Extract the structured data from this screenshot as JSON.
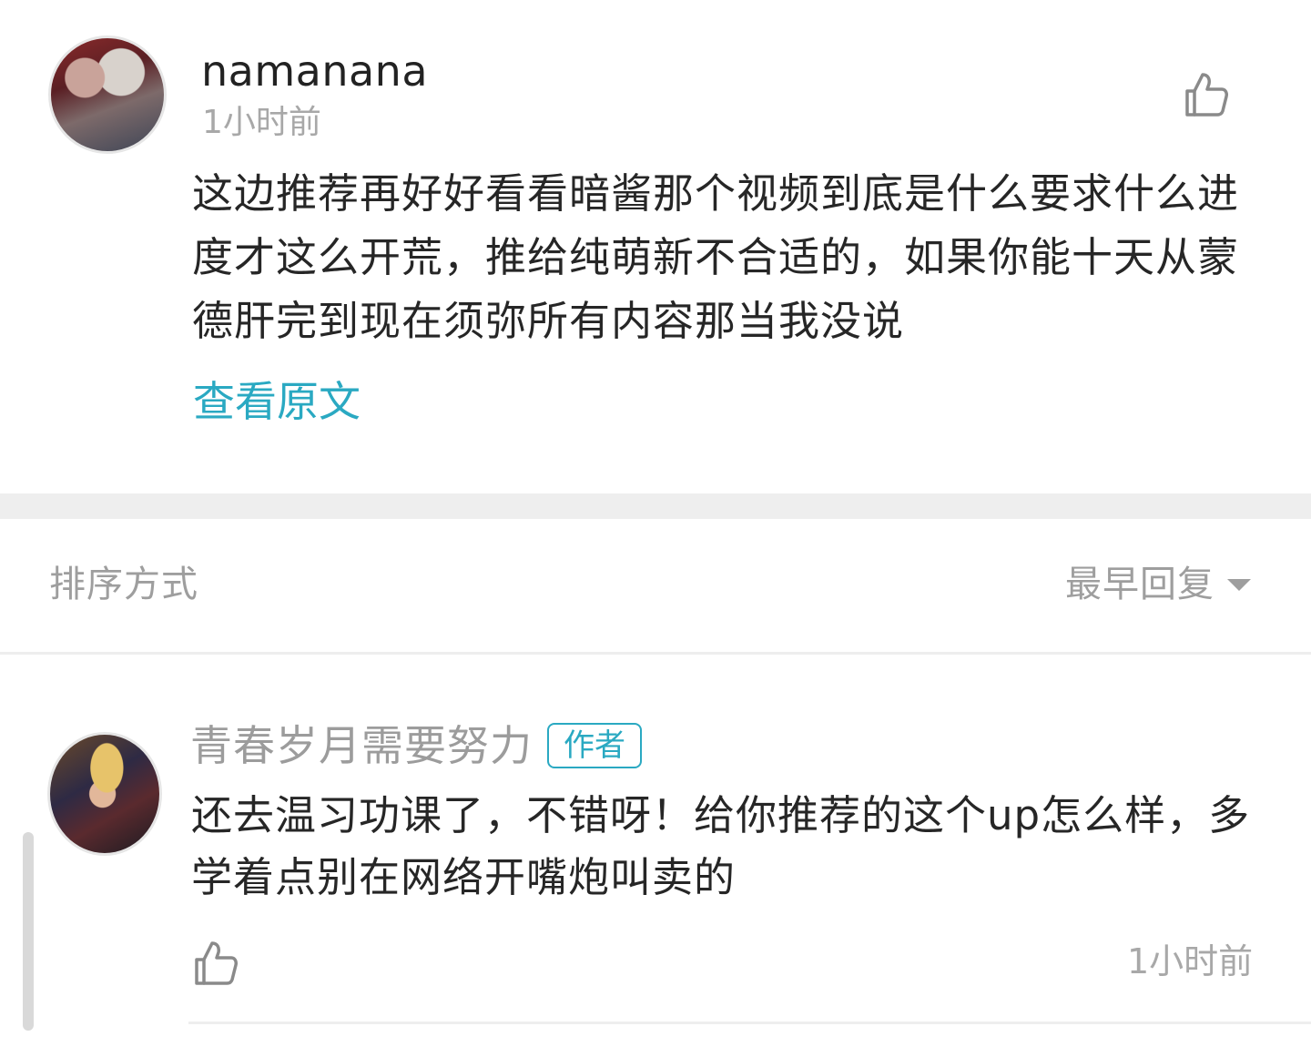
{
  "top_comment": {
    "username": "namanana",
    "time": "1小时前",
    "text": "这边推荐再好好看看暗酱那个视频到底是什么要求什么进度才这么开荒，推给纯萌新不合适的，如果你能十天从蒙德肝完到现在须弥所有内容那当我没说",
    "view_original_label": "查看原文",
    "like_icon": "thumbs-up-icon"
  },
  "sort": {
    "label": "排序方式",
    "selected": "最早回复",
    "caret_icon": "caret-down-icon"
  },
  "reply": {
    "username": "青春岁月需要努力",
    "badge": "作者",
    "text": "还去温习功课了，不错呀！给你推荐的这个up怎么样，多学着点别在网络开嘴炮叫卖的",
    "time": "1小时前",
    "like_icon": "thumbs-up-icon"
  },
  "colors": {
    "accent": "#2aa9c2",
    "muted_text": "#a8a8a8",
    "body_text": "#262626",
    "divider": "#eeeeee"
  }
}
